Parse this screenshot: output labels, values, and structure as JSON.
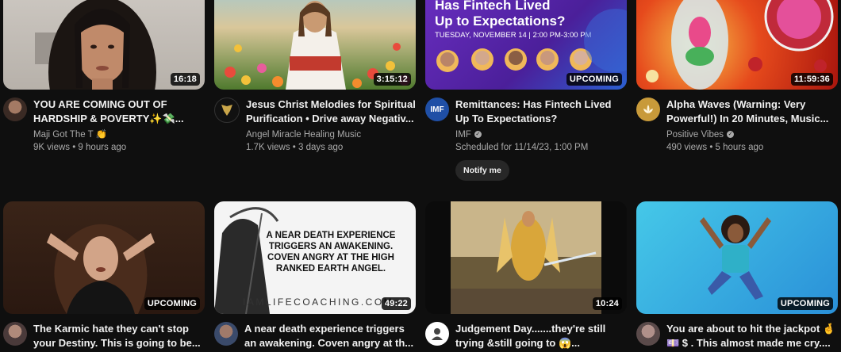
{
  "videos": [
    {
      "title": "YOU ARE COMING OUT OF HARDSHIP & POVERTY✨💸...",
      "channel": "Maji Got The T 👏",
      "stats": "9K views • 9 hours ago",
      "badge": "16:18"
    },
    {
      "title": "Jesus Christ Melodies for Spiritual Purification • Drive away Negativ...",
      "channel": "Angel Miracle Healing Music",
      "stats": "1.7K views • 3 days ago",
      "badge": "3:15:12"
    },
    {
      "title": "Remittances: Has Fintech Lived Up To Expectations?",
      "channel": "IMF",
      "stats": "Scheduled for 11/14/23, 1:00 PM",
      "badge": "UPCOMING",
      "notify": "Notify me",
      "avatar_text": "IMF",
      "thumb_title": "Has Fintech Lived\nUp to Expectations?",
      "thumb_date": "TUESDAY, NOVEMBER 14 | 2:00 PM-3:00 PM"
    },
    {
      "title": "Alpha Waves (Warning: Very Powerful!) In 20 Minutes, Music...",
      "channel": "Positive Vibes",
      "stats": "490 views • 5 hours ago",
      "badge": "11:59:36"
    },
    {
      "title": "The Karmic hate they can't stop your Destiny. This is going to be...",
      "channel": "",
      "stats": "",
      "badge": "UPCOMING"
    },
    {
      "title": "A near death experience triggers an awakening. Coven angry at th...",
      "channel": "",
      "stats": "",
      "badge": "49:22",
      "thumb_text": "A NEAR DEATH EXPERIENCE TRIGGERS AN AWAKENING. COVEN ANGRY AT THE HIGH RANKED EARTH ANGEL.",
      "thumb_url": "IAMLIFECOACHING.COM"
    },
    {
      "title": "Judgement Day.......they're still trying &still going to 😱...",
      "channel": "",
      "stats": "",
      "badge": "10:24"
    },
    {
      "title": "You are about to hit the jackpot 🤞 💷 $ . This almost made me cry....",
      "channel": "",
      "stats": "",
      "badge": "UPCOMING"
    }
  ],
  "colors": {
    "bg": "#0f0f0f",
    "meta": "#aaaaaa",
    "button": "#272727"
  }
}
